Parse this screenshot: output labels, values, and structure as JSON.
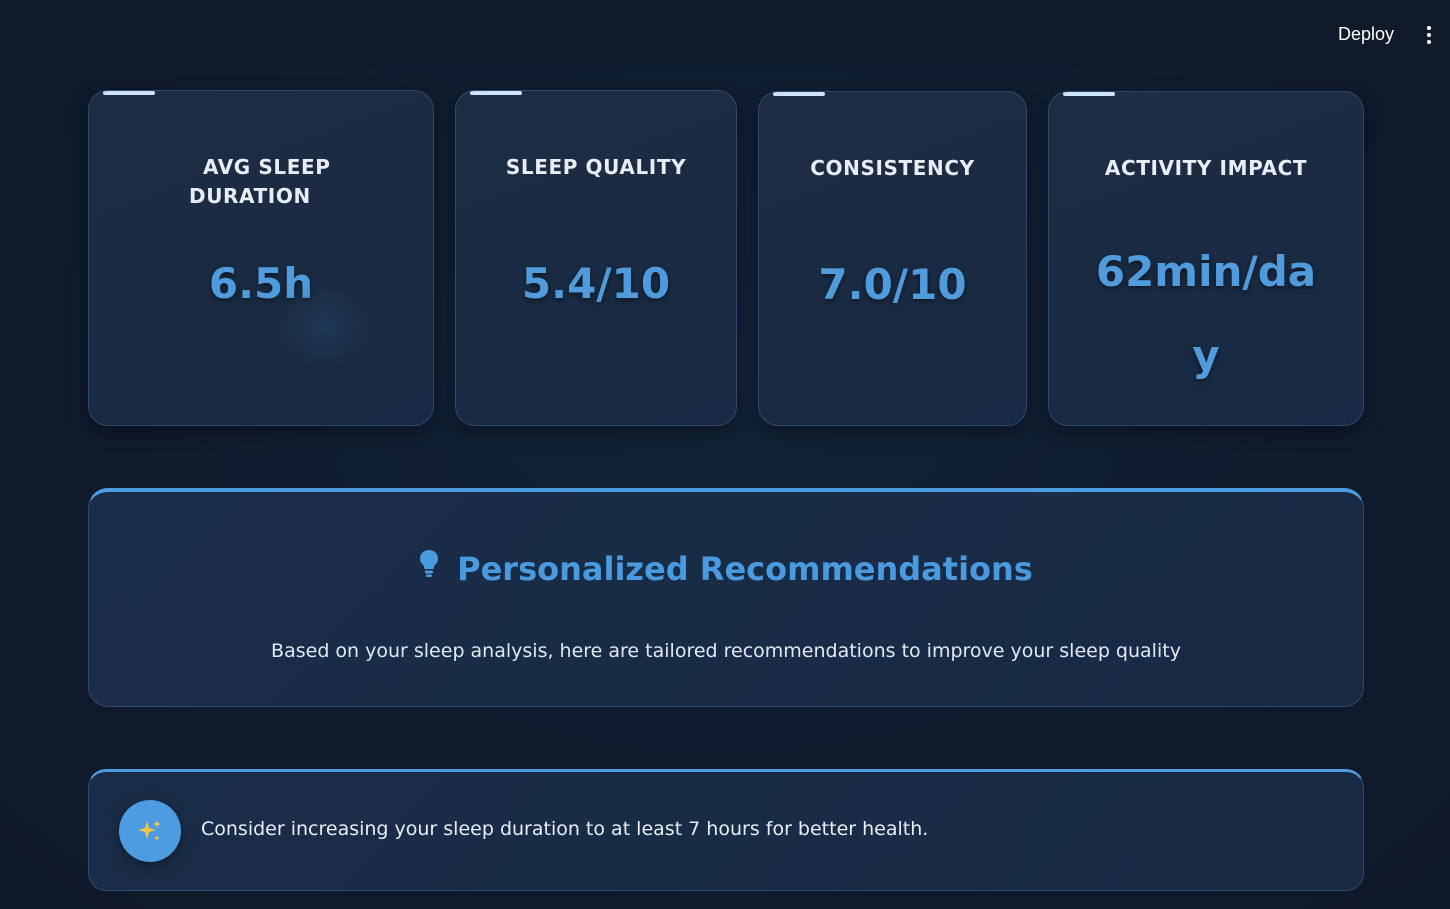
{
  "header": {
    "deploy_label": "Deploy",
    "menu_icon": "more-vertical-icon"
  },
  "metrics": [
    {
      "label_line1": "AVG SLEEP",
      "label_line2": "DURATION",
      "value": "6.5h"
    },
    {
      "label": "SLEEP QUALITY",
      "value": "5.4/10"
    },
    {
      "label": "CONSISTENCY",
      "value": "7.0/10"
    },
    {
      "label": "ACTIVITY IMPACT",
      "value_line1": "62min/da",
      "value_line2": "y"
    }
  ],
  "recommendations": {
    "icon": "lightbulb-icon",
    "title": "Personalized Recommendations",
    "subtitle": "Based on your sleep analysis, here are tailored recommendations to improve your sleep quality",
    "items": [
      {
        "icon": "sparkles-icon",
        "text": "Consider increasing your sleep duration to at least 7 hours for better health."
      }
    ]
  },
  "colors": {
    "accent": "#4d9be0",
    "value_text": "#4f9bdb",
    "background": "#0f1b2d"
  }
}
